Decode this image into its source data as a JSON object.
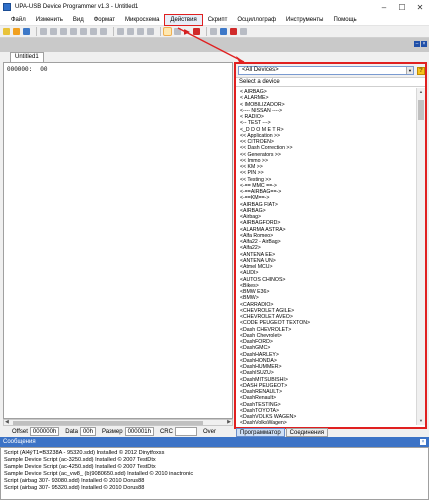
{
  "window": {
    "title": "UPA-USB Device Programmer v1.3 - Untitled1"
  },
  "menu": [
    "Файл",
    "Изменить",
    "Вид",
    "Формат",
    "Микросхема",
    "Действия",
    "Скрипт",
    "Осциллограф",
    "Инструменты",
    "Помощь"
  ],
  "selected_menu": "Действия",
  "document": {
    "tab": "Untitled1",
    "address": "000000:",
    "value": "00"
  },
  "status": {
    "offset_label": "Offset",
    "offset_value": "000000h",
    "data_label": "Data",
    "data_value": "00h",
    "size_label": "Размер",
    "size_value": "000001h",
    "crc_label": "CRC",
    "over_label": "Over"
  },
  "device_panel": {
    "filter": "<All Devices>",
    "header": "Select a device",
    "devices": [
      "< AIRBAG>",
      "< ALARME>",
      "< IMOBILIZADOR>",
      "<---- NISSAN ---->",
      "< RADIO>",
      "<-- TEST --->",
      "<_D D O M E T R>",
      "<< Application >>",
      "<< CITROEN>",
      "<< Dash Correction >>",
      "<< Generators >>",
      "<< Immo >>",
      "<< KM >>",
      "<< PIN >>",
      "<< Testing >>",
      "<-== MMC ==->",
      "<-==AIRBAG==->",
      "<-==KM==->",
      "<AIRBAG FIAT>",
      "<AIRBAG>",
      "<Airbag>",
      "<AIRBAGFORD>",
      "<ALARMA ASTRA>",
      "<Alfa Romeo>",
      "<Alfa22 - AirBag>",
      "<Alfa22>",
      "<ANTENA EE>",
      "<ANTENA UN>",
      "<Atmel MCU>",
      "<AUDI>",
      "<AUTOS CHINOS>",
      "<Bikes>",
      "<BMW E36>",
      "<BMW>",
      "<CARRADIO>",
      "<CHEVROLET AGILE>",
      "<CHEVROLET AVEO>",
      "<CODE PEUGEOT TEXTON>",
      "<Dash CHEVROLET>",
      "<Dash Chevrolet>",
      "<DashFORD>",
      "<DashGMC>",
      "<DashHARLEY>",
      "<DashHONDA>",
      "<DashHUMMER>",
      "<DashISUZU>",
      "<DashMITSUBISHI>",
      "<DASH PEUGEOT>",
      "<DashRENAULT>",
      "<DashRenault>",
      "<DashTESTING>",
      "<DashTOYOTA>",
      "<DashVOLKS WAGEN>",
      "<DashVolksWagen>"
    ]
  },
  "bottom_tabs": [
    "Программатор",
    "Соединения"
  ],
  "messages": {
    "title": "Сообщения",
    "lines": [
      "Script (Al4ýT1=B3238A - 95320.sdd) Installed © 2012 Dinytfoxss",
      "Sample Device Script (ac-3250.sdd) Installed © 2007 TestDtx",
      "Sample Device Script (ac-4250.sdd) Installed © 2007 TestDtx",
      "Sample Device Script (ac_vw8_ (b)9080650.sdd) Installed © 2010 inactronic",
      "Script (airbag 307- 93080.sdd) Installed © 2010 Dorus88",
      "Script (airbag 307- 95320.sdd) Installed © 2010 Dorus88"
    ]
  }
}
